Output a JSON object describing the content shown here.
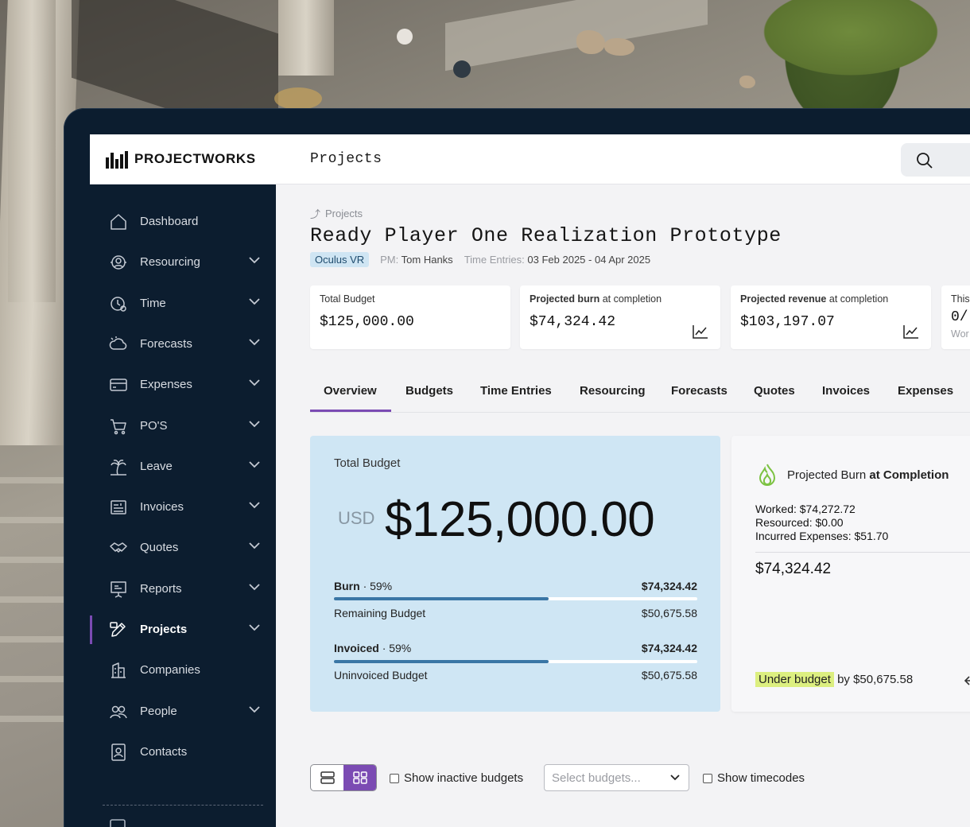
{
  "brand": {
    "name": "PROJECTWORKS"
  },
  "header": {
    "title": "Projects",
    "search_icon": "search-icon"
  },
  "sidebar": {
    "items": [
      {
        "label": "Dashboard",
        "icon": "home-icon",
        "has_chevron": false
      },
      {
        "label": "Resourcing",
        "icon": "resourcing-icon",
        "has_chevron": true
      },
      {
        "label": "Time",
        "icon": "clock-icon",
        "has_chevron": true
      },
      {
        "label": "Forecasts",
        "icon": "forecast-icon",
        "has_chevron": true
      },
      {
        "label": "Expenses",
        "icon": "card-icon",
        "has_chevron": true
      },
      {
        "label": "PO'S",
        "icon": "cart-icon",
        "has_chevron": true
      },
      {
        "label": "Leave",
        "icon": "palm-tree-icon",
        "has_chevron": true
      },
      {
        "label": "Invoices",
        "icon": "invoice-icon",
        "has_chevron": true
      },
      {
        "label": "Quotes",
        "icon": "handshake-icon",
        "has_chevron": true
      },
      {
        "label": "Reports",
        "icon": "presentation-icon",
        "has_chevron": true
      },
      {
        "label": "Projects",
        "icon": "pencil-icon",
        "has_chevron": true,
        "active": true
      },
      {
        "label": "Companies",
        "icon": "building-icon",
        "has_chevron": false
      },
      {
        "label": "People",
        "icon": "people-icon",
        "has_chevron": true
      },
      {
        "label": "Contacts",
        "icon": "contact-icon",
        "has_chevron": false
      }
    ]
  },
  "breadcrumb": {
    "label": "Projects"
  },
  "project": {
    "title": "Ready Player One Realization Prototype",
    "tag": "Oculus VR",
    "pm_key": "PM:",
    "pm_value": "Tom Hanks",
    "time_key": "Time Entries:",
    "time_value": "03 Feb 2025 - 04 Apr 2025"
  },
  "stats": {
    "total_budget": {
      "label": "Total Budget",
      "value": "$125,000.00"
    },
    "projected_burn": {
      "label_bold": "Projected burn",
      "label_rest": "at completion",
      "value": "$74,324.42"
    },
    "projected_revenue": {
      "label_bold": "Projected revenue",
      "label_rest": "at completion",
      "value": "$103,197.07"
    },
    "partial": {
      "label": "This",
      "value": "0/",
      "sub": "Wor"
    }
  },
  "tabs": [
    "Overview",
    "Budgets",
    "Time Entries",
    "Resourcing",
    "Forecasts",
    "Quotes",
    "Invoices",
    "Expenses"
  ],
  "budget_panel": {
    "label": "Total Budget",
    "currency": "USD",
    "amount": "$125,000.00",
    "burn_label": "Burn",
    "burn_pct_text": "· 59%",
    "burn_value": "$74,324.42",
    "burn_fraction": 0.59,
    "remaining_label": "Remaining Budget",
    "remaining_value": "$50,675.58",
    "invoiced_label": "Invoiced",
    "invoiced_pct_text": "· 59%",
    "invoiced_value": "$74,324.42",
    "invoiced_fraction": 0.59,
    "uninvoiced_label": "Uninvoiced Budget",
    "uninvoiced_value": "$50,675.58"
  },
  "burn_panel": {
    "title": "Projected Burn",
    "title_bold": "at Completion",
    "worked": "Worked: $74,272.72",
    "resourced": "Resourced: $0.00",
    "incurred": "Incurred Expenses: $51.70",
    "total": "$74,324.42",
    "status_highlight": "Under budget",
    "status_rest": "by $50,675.58",
    "accent_color": "#7cc242"
  },
  "controls": {
    "show_inactive": "Show inactive budgets",
    "select_placeholder": "Select budgets...",
    "show_timecodes": "Show timecodes"
  },
  "colors": {
    "accent_purple": "#7b4bb3",
    "sidebar_bg": "#0c1d2f",
    "budget_bg": "#cfe6f4",
    "bar_fill": "#3a76a5"
  }
}
